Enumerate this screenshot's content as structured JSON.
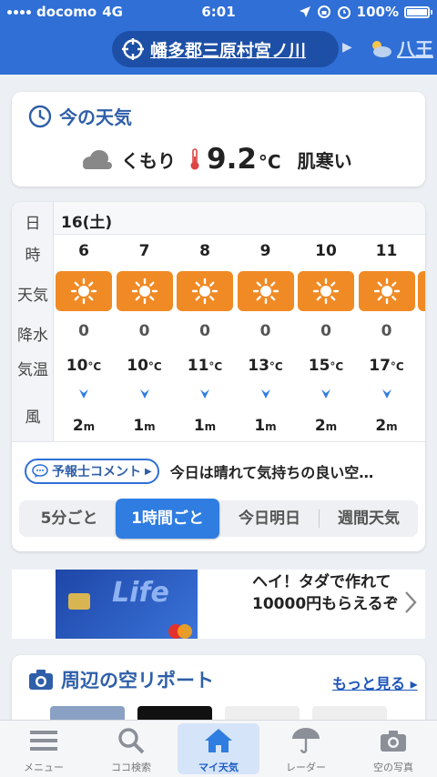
{
  "status_bar": {
    "carrier": "docomo",
    "network": "4G",
    "time": "6:01",
    "battery": "100%",
    "battery_level": 1.0
  },
  "header": {
    "location": "幡多郡三原村宮ノ川",
    "next_location": "八王"
  },
  "now": {
    "title": "今の天気",
    "condition": "くもり",
    "temp": "9.2",
    "unit": "°C",
    "feel": "肌寒い"
  },
  "hourly": {
    "labels": {
      "day": "日",
      "hour": "時",
      "weather": "天気",
      "precip": "降水",
      "temp": "気温",
      "wind": "風"
    },
    "date": "16(土)",
    "hours": [
      {
        "hour": "6",
        "precip": "0",
        "temp": "10",
        "wind": "2"
      },
      {
        "hour": "7",
        "precip": "0",
        "temp": "10",
        "wind": "1"
      },
      {
        "hour": "8",
        "precip": "0",
        "temp": "11",
        "wind": "1"
      },
      {
        "hour": "9",
        "precip": "0",
        "temp": "13",
        "wind": "1"
      },
      {
        "hour": "10",
        "precip": "0",
        "temp": "15",
        "wind": "2"
      },
      {
        "hour": "11",
        "precip": "0",
        "temp": "17",
        "wind": "2"
      }
    ],
    "temp_unit": "°C",
    "wind_unit": "m"
  },
  "comment": {
    "button": "予報士コメント",
    "text": "今日は晴れて気持ちの良い空…"
  },
  "tabs": [
    "5分ごと",
    "1時間ごと",
    "今日明日",
    "週間天気"
  ],
  "active_tab": 1,
  "ad": {
    "text": "ヘイ！タダで作れて10000円もらえるぞ",
    "card_brand": "Life"
  },
  "report": {
    "title": "周辺の空リポート",
    "more": "もっと見る"
  },
  "tabbar": [
    {
      "label": "メニュー",
      "icon": "menu-icon"
    },
    {
      "label": "ココ検索",
      "icon": "search-icon"
    },
    {
      "label": "マイ天気",
      "icon": "home-icon"
    },
    {
      "label": "レーダー",
      "icon": "umbrella-icon"
    },
    {
      "label": "空の写真",
      "icon": "camera-icon"
    }
  ],
  "colors": {
    "header": "#2f6fd6",
    "accent": "#2f7de0",
    "sunny_bg": "#f08a24"
  }
}
